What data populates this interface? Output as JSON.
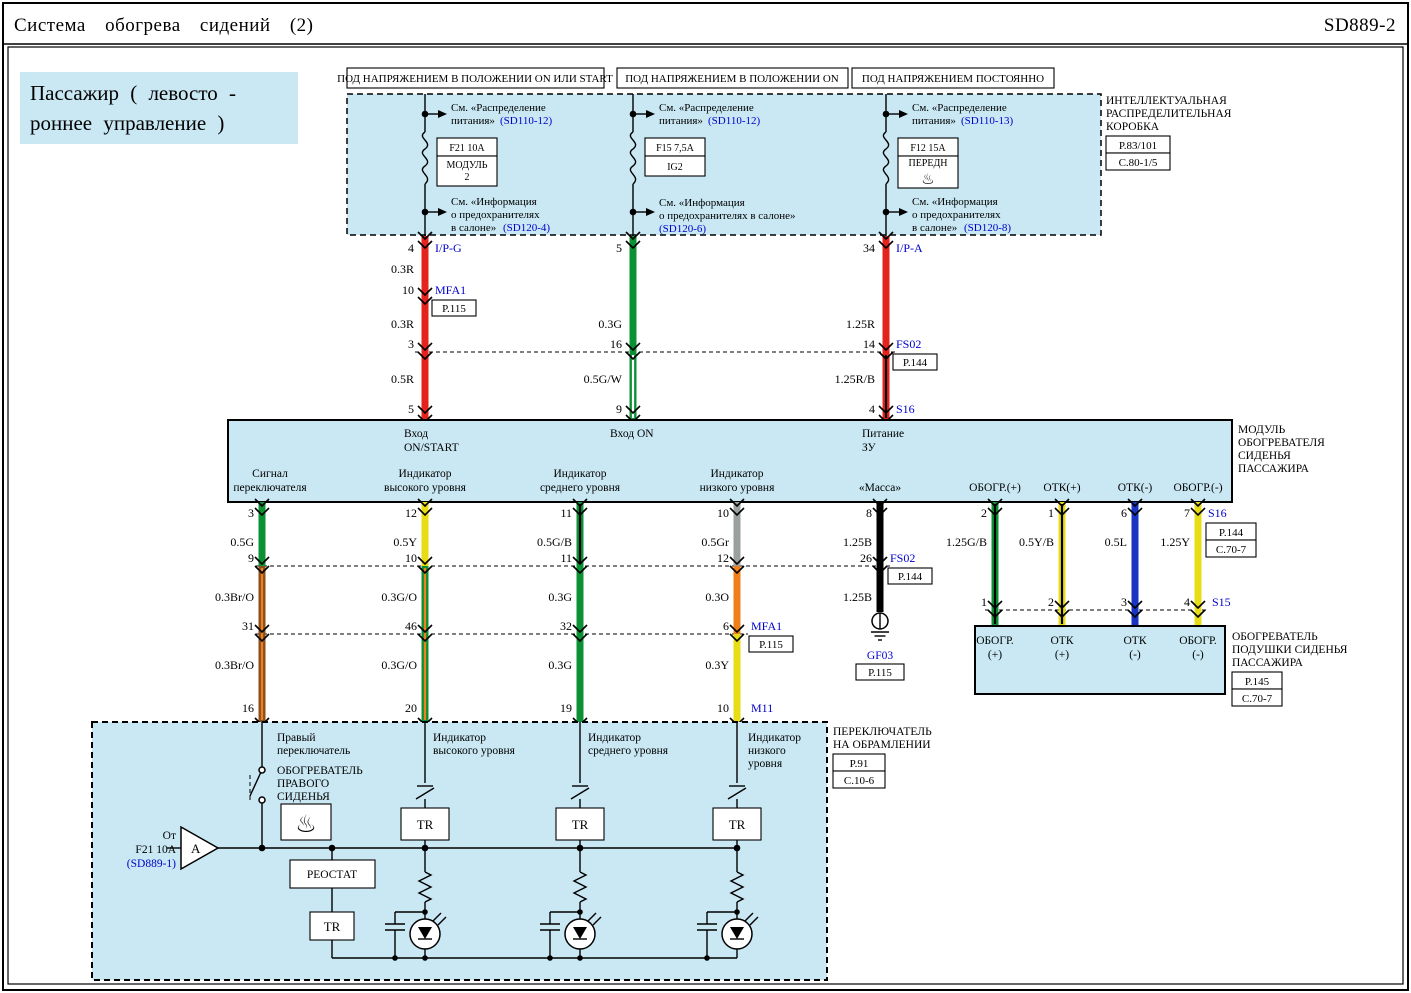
{
  "header": {
    "title": "Система обогрева сидений (2)",
    "code": "SD889-2"
  },
  "subtitle": {
    "line1": "Пассажир ( левосто -",
    "line2": "роннее управление )"
  },
  "power_conditions": [
    "ПОД НАПРЯЖЕНИЕМ В ПОЛОЖЕНИИ ON ИЛИ START",
    "ПОД НАПРЯЖЕНИЕМ В ПОЛОЖЕНИИ ON",
    "ПОД НАПРЯЖЕНИЕМ ПОСТОЯННО"
  ],
  "junction_box": {
    "name1": "ИНТЕЛЛЕКТУАЛЬНАЯ",
    "name2": "РАСПРЕДЕЛИТЕЛЬНАЯ",
    "name3": "КОРОБКА",
    "page_ref": "P.83/101",
    "conn_ref": "C.80-1/5",
    "col1": {
      "top1": "См. «Распределение",
      "top2": "питания»",
      "top_link": "(SD110-12)",
      "fuse": "F21 10A",
      "circuit1": "МОДУЛЬ",
      "circuit2": "2",
      "bot1": "См. «Информация",
      "bot2": "о предохранителях",
      "bot3": "в салоне»",
      "bot_link": "(SD120-4)"
    },
    "col2": {
      "top1": "См. «Распределение",
      "top2": "питания»",
      "top_link": "(SD110-12)",
      "fuse": "F15 7,5A",
      "circuit1": "IG2",
      "bot1": "См. «Информация",
      "bot2": "о предохранителях  в салоне»",
      "bot_link": "(SD120-6)"
    },
    "col3": {
      "top1": "См. «Распределение",
      "top2": "питания»",
      "top_link": "(SD110-13)",
      "fuse": "F12 15A",
      "circuit1": "ПЕРЕДН",
      "circuit_icon": "♨",
      "bot1": "См. «Информация",
      "bot2": "о предохранителях",
      "bot3": "в салоне»",
      "bot_link": "(SD120-8)"
    }
  },
  "supply": {
    "left": {
      "pin_top": "4",
      "name_top": "I/P-G",
      "g1": "0.3R",
      "pin_mid": "10",
      "name_mid": "MFA1",
      "ref_mid": "P.115",
      "g2": "0.3R",
      "pin_join": "3",
      "g3": "0.5R",
      "pin_bot": "5"
    },
    "center": {
      "pin_top": "5",
      "g2": "0.3G",
      "pin_join": "16",
      "g3": "0.5G/W",
      "pin_bot": "9"
    },
    "right": {
      "pin_top": "34",
      "name_top": "I/P-A",
      "g2": "1.25R",
      "pin_join": "14",
      "name_join": "FS02",
      "ref_join": "P.144",
      "g3": "1.25R/B",
      "pin_bot": "4",
      "name_bot": "S16"
    }
  },
  "module": {
    "in1a": "Вход",
    "in1b": "ON/START",
    "in2": "Вход ON",
    "in3a": "Питание",
    "in3b": "ЗУ",
    "out1a": "Сигнал",
    "out1b": "переключателя",
    "out2a": "Индикатор",
    "out2b": "высокого  уровня",
    "out3a": "Индикатор",
    "out3b": "среднего  уровня",
    "out4a": "Индикатор",
    "out4b": "низкого  уровня",
    "out5": "«Масса»",
    "out6": "ОБОГР.(+)",
    "out7": "ОТК(+)",
    "out8": "ОТК(-)",
    "out9": "ОБОГР.(-)",
    "name1": "МОДУЛЬ",
    "name2": "ОБОГРЕВАТЕЛЯ",
    "name3": "СИДЕНЬЯ",
    "name4": "ПАССАЖИРА"
  },
  "below": {
    "w1": {
      "p1": "3",
      "g1": "0.5G",
      "p2": "9",
      "g2": "0.3Br/O",
      "p3": "31",
      "g3": "0.3Br/O",
      "p4": "16"
    },
    "w2": {
      "p1": "12",
      "g1": "0.5Y",
      "p2": "10",
      "g2": "0.3G/O",
      "p3": "46",
      "g3": "0.3G/O",
      "p4": "20"
    },
    "w3": {
      "p1": "11",
      "g1": "0.5G/B",
      "p2": "11",
      "g2": "0.3G",
      "p3": "32",
      "g3": "0.3G",
      "p4": "19"
    },
    "w4": {
      "p1": "10",
      "g1": "0.5Gr",
      "p2": "12",
      "g2": "0.3O",
      "p3": "6",
      "n3": "MFA1",
      "r3": "P.115",
      "g3": "0.3Y",
      "p4": "10",
      "n4": "M11"
    },
    "w5": {
      "p1": "8",
      "g1": "1.25B",
      "p2": "26",
      "n2": "FS02",
      "r2": "P.144",
      "g2": "1.25B",
      "gnd": "GF03",
      "gnd_ref": "P.115"
    },
    "s16": "S16",
    "s16_r1": "P.144",
    "s16_r2": "C.70-7",
    "s15": "S15",
    "h1": {
      "p1": "2",
      "g": "1.25G/B",
      "p2": "1"
    },
    "h2": {
      "p1": "1",
      "g": "0.5Y/B",
      "p2": "2"
    },
    "h3": {
      "p1": "6",
      "g": "0.5L",
      "p2": "3"
    },
    "h4": {
      "p1": "7",
      "g": "1.25Y",
      "p2": "4"
    }
  },
  "cushion": {
    "t1a": "ОБОГР.",
    "t1b": "(+)",
    "t2a": "ОТК",
    "t2b": "(+)",
    "t3a": "ОТК",
    "t3b": "(-)",
    "t4a": "ОБОГР.",
    "t4b": "(-)",
    "name1": "ОБОГРЕВАТЕЛЬ",
    "name2": "ПОДУШКИ СИДЕНЬЯ",
    "name3": "ПАССАЖИРА",
    "ref1": "P.145",
    "ref2": "C.70-7"
  },
  "switchbox": {
    "name1": "ПЕРЕКЛЮЧАТЕЛЬ",
    "name2": "НА ОБРАМЛЕНИИ",
    "ref1": "P.91",
    "ref2": "C.10-6",
    "sw1": "Правый",
    "sw2": "переключатель",
    "heat1": "ОБОГРЕВАТЕЛЬ",
    "heat2": "ПРАВОГО",
    "heat3": "СИДЕНЬЯ",
    "seat_icon": "♨",
    "ind1a": "Индикатор",
    "ind1b": "высокого  уровня",
    "ind2a": "Индикатор",
    "ind2b": "среднего  уровня",
    "ind3a": "Индикатор",
    "ind3b": "низкого",
    "ind3c": "уровня",
    "tr": "TR",
    "rheostat": "РЕОСТАТ",
    "src1": "От",
    "src2": "F21 10A",
    "src_link": "(SD889-1)",
    "amp": "A"
  },
  "colors": {
    "panel_blue": "#c9e8f3",
    "red": "#e3231c",
    "green": "#0b9134",
    "yellow": "#e8dc16",
    "orange": "#ef7f1a",
    "brown": "#8a4d1e",
    "gray": "#9aa0a0",
    "blue": "#1734c4",
    "black": "#000000",
    "link_blue": "#0000cc"
  }
}
